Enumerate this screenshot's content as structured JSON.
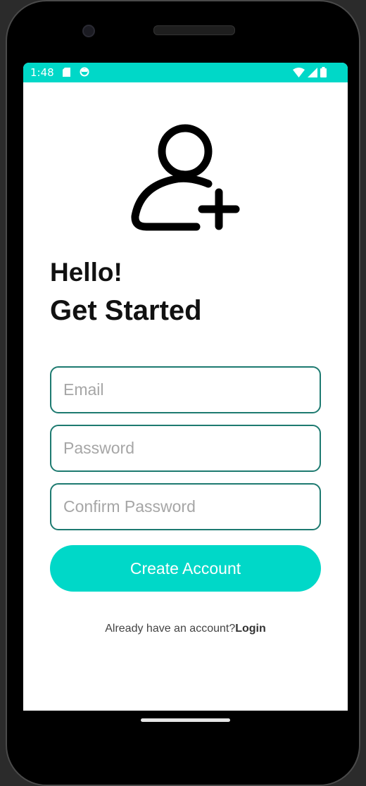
{
  "status_bar": {
    "time": "1:48",
    "color": "#00d8c8",
    "icons": [
      "sd-card-icon",
      "sync-circle-icon",
      "wifi-icon",
      "signal-icon",
      "battery-icon"
    ]
  },
  "header": {
    "icon": "add-user-icon",
    "greeting": "Hello!",
    "title": "Get Started"
  },
  "form": {
    "email": {
      "value": "",
      "placeholder": "Email"
    },
    "password": {
      "value": "",
      "placeholder": "Password"
    },
    "confirm_password": {
      "value": "",
      "placeholder": "Confirm Password"
    },
    "submit_label": "Create Account",
    "accent_color": "#00d8c8",
    "border_color": "#1d7a70"
  },
  "footer": {
    "prompt": "Already have an account?",
    "link_label": "Login"
  }
}
